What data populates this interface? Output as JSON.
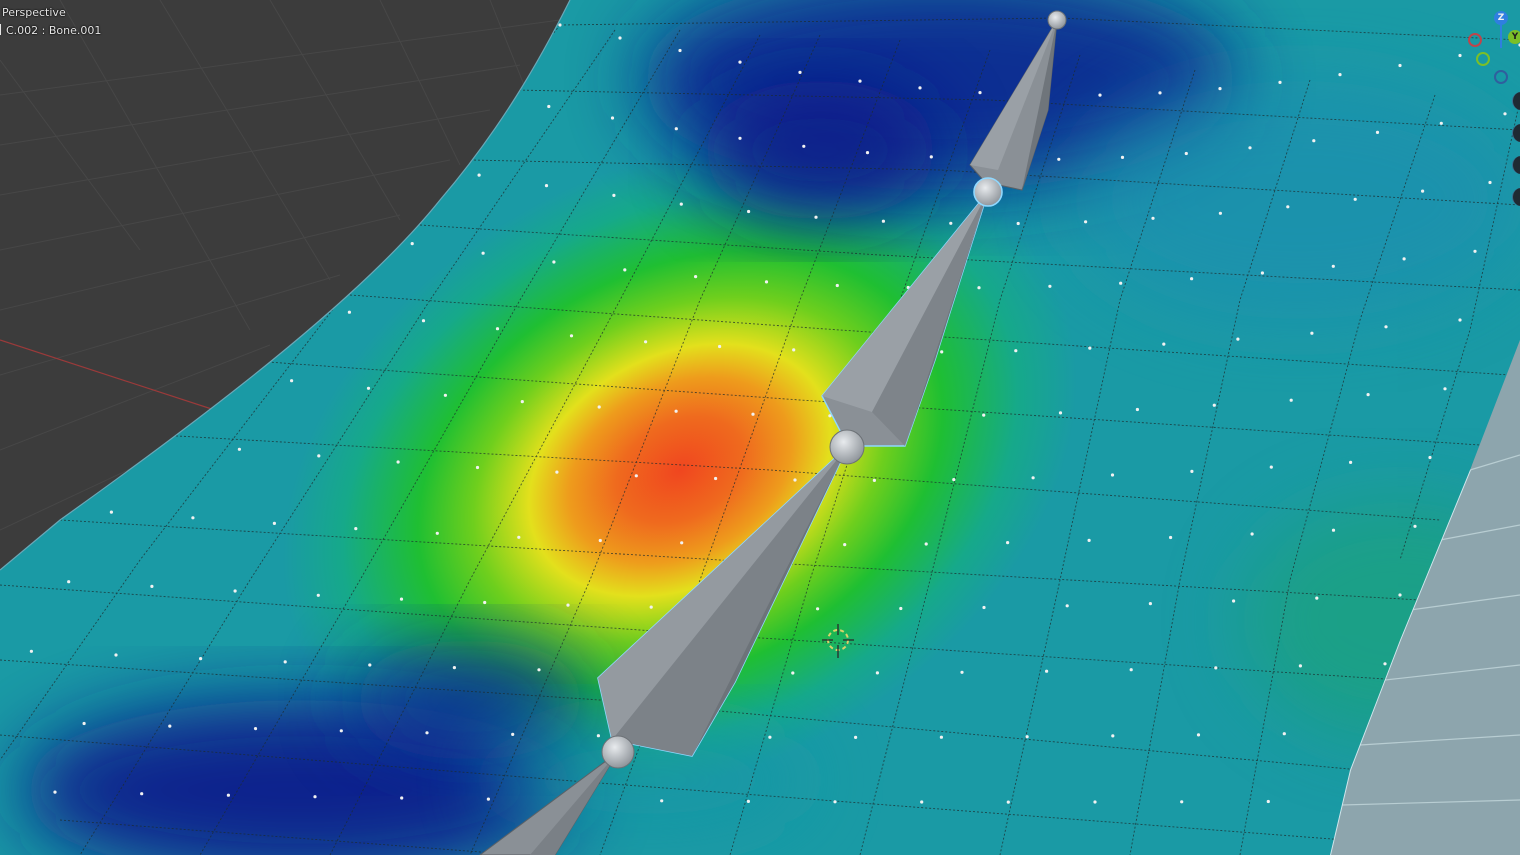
{
  "viewport": {
    "view_mode": "Perspective",
    "object_info": "C.002 : Bone.001"
  },
  "navigation_gizmo": {
    "axes": [
      {
        "label": "Z",
        "color": "#2f7fe0"
      },
      {
        "label": "Y",
        "color": "#7bbf28"
      },
      {
        "label": "",
        "color": "#c0444a"
      },
      {
        "label": "",
        "color": "#7bbf28"
      },
      {
        "label": "",
        "color": "#2f5f9e"
      }
    ]
  },
  "weight_paint": {
    "gradient": [
      "#0b1e8c",
      "#1a9aa5",
      "#1fbf32",
      "#e3e01c",
      "#ef8a1c",
      "#f0461f"
    ],
    "grid_rows": 12,
    "grid_cols": 16
  },
  "armature": {
    "bone_color": "#8a9096",
    "selected_outline": "#8fd8ff",
    "bone_count": 4
  },
  "icons": {
    "cursor": "3d-cursor-icon",
    "gizmo": "navigation-gizmo-icon"
  }
}
